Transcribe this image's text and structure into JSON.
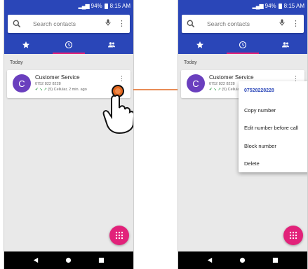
{
  "status": {
    "battery": "94%",
    "time": "8:15 AM"
  },
  "search": {
    "placeholder": "Search contacts"
  },
  "tabs": [
    {
      "icon": "star-icon",
      "label": "Favorites"
    },
    {
      "icon": "clock-icon",
      "label": "Recents"
    },
    {
      "icon": "people-icon",
      "label": "Contacts"
    }
  ],
  "section_label": "Today",
  "call": {
    "avatar_letter": "C",
    "name": "Customer Service",
    "number": "0752 822 8228",
    "meta": "(5) Cellular, 2 min. ago",
    "meta_icons": "✔ ↘ ↗"
  },
  "menu": {
    "header": "07528228228",
    "items": [
      "Copy number",
      "Edit number before call",
      "Block number",
      "Delete"
    ]
  },
  "colors": {
    "primary": "#2a46b8",
    "accent": "#e2227a",
    "avatar": "#6a3fbe",
    "tap_indicator": "#e0661f"
  }
}
